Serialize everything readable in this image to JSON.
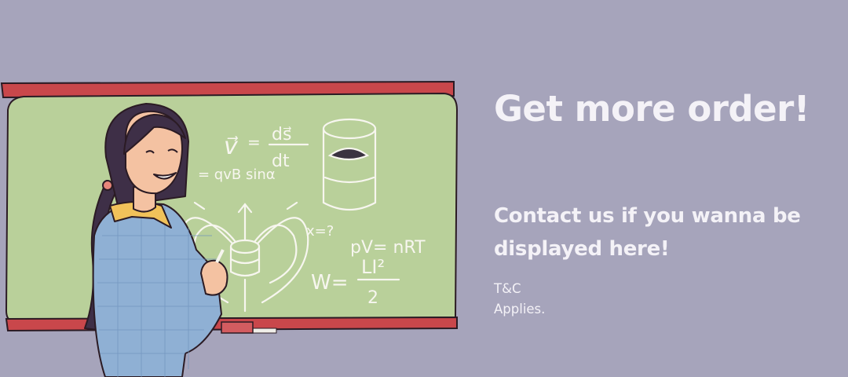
{
  "banner": {
    "headline": "Get more order!",
    "subheading": "Contact us if you wanna be displayed here!",
    "note_line1": "T&C",
    "note_line2": "Applies."
  },
  "illustration": {
    "eq_velocity_v": "v⃗",
    "eq_velocity_num": "ds⃗",
    "eq_velocity_den": "dt",
    "eq_force": "= qvB sinα",
    "eq_unknown": "x=?",
    "eq_gas": "pV= nRT",
    "eq_energy_w": "W=",
    "eq_energy_num": "LI²",
    "eq_energy_den": "2"
  },
  "colors": {
    "background": "#a6a4bb",
    "board": "#b9d09a",
    "board_frame": "#c9474b",
    "text": "#f4f2f7"
  }
}
